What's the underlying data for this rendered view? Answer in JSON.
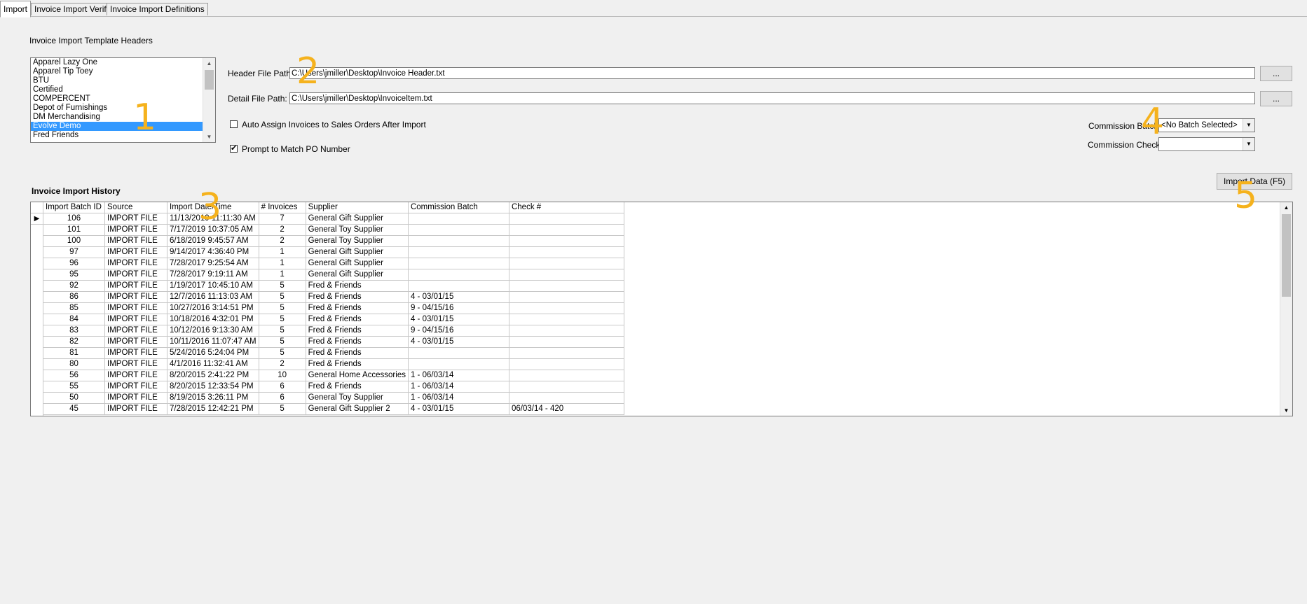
{
  "tabs": [
    "Import",
    "Invoice Import Verify",
    "Invoice Import Definitions"
  ],
  "templates": {
    "section_label": "Invoice Import Template Headers",
    "items": [
      "Apparel Lazy One",
      "Apparel Tip Toey",
      "BTU",
      "Certified",
      "COMPERCENT",
      "Depot of Furnishings",
      "DM Merchandising",
      "Evolve Demo",
      "Fred Friends"
    ],
    "selected": "Evolve Demo"
  },
  "paths": {
    "header_label": "Header File Path:",
    "header_value": "C:\\Users\\jmiller\\Desktop\\Invoice Header.txt",
    "detail_label": "Detail File Path:",
    "detail_value": "C:\\Users\\jmiller\\Desktop\\InvoiceItem.txt",
    "browse_label": "..."
  },
  "options": {
    "auto_assign_label": "Auto Assign Invoices to Sales Orders After Import",
    "auto_assign_checked": false,
    "prompt_match_label": "Prompt to Match PO Number",
    "prompt_match_checked": true,
    "check_mark": "✔"
  },
  "commission": {
    "batch_label": "Commission Batch",
    "batch_value": "<No Batch Selected>",
    "check_label": "Commission Check",
    "check_value": ""
  },
  "import_button": "Import Data (F5)",
  "history": {
    "title": "Invoice Import History",
    "columns": [
      "Import Batch ID",
      "Source",
      "Import Date/Time",
      "# Invoices",
      "Supplier",
      "Commission Batch",
      "Check #"
    ],
    "rows": [
      [
        "106",
        "IMPORT FILE",
        "11/13/2019 11:11:30 AM",
        "7",
        "General Gift Supplier",
        "",
        ""
      ],
      [
        "101",
        "IMPORT FILE",
        "7/17/2019 10:37:05 AM",
        "2",
        "General Toy Supplier",
        "",
        ""
      ],
      [
        "100",
        "IMPORT FILE",
        "6/18/2019 9:45:57 AM",
        "2",
        "General Toy Supplier",
        "",
        ""
      ],
      [
        "97",
        "IMPORT FILE",
        "9/14/2017 4:36:40 PM",
        "1",
        "General Gift Supplier",
        "",
        ""
      ],
      [
        "96",
        "IMPORT FILE",
        "7/28/2017 9:25:54 AM",
        "1",
        "General Gift Supplier",
        "",
        ""
      ],
      [
        "95",
        "IMPORT FILE",
        "7/28/2017 9:19:11 AM",
        "1",
        "General Gift Supplier",
        "",
        ""
      ],
      [
        "92",
        "IMPORT FILE",
        "1/19/2017 10:45:10 AM",
        "5",
        "Fred & Friends",
        "",
        ""
      ],
      [
        "86",
        "IMPORT FILE",
        "12/7/2016 11:13:03 AM",
        "5",
        "Fred & Friends",
        "4 - 03/01/15",
        ""
      ],
      [
        "85",
        "IMPORT FILE",
        "10/27/2016 3:14:51 PM",
        "5",
        "Fred & Friends",
        "9 - 04/15/16",
        ""
      ],
      [
        "84",
        "IMPORT FILE",
        "10/18/2016 4:32:01 PM",
        "5",
        "Fred & Friends",
        "4 - 03/01/15",
        ""
      ],
      [
        "83",
        "IMPORT FILE",
        "10/12/2016 9:13:30 AM",
        "5",
        "Fred & Friends",
        "9 - 04/15/16",
        ""
      ],
      [
        "82",
        "IMPORT FILE",
        "10/11/2016 11:07:47 AM",
        "5",
        "Fred & Friends",
        "4 - 03/01/15",
        ""
      ],
      [
        "81",
        "IMPORT FILE",
        "5/24/2016 5:24:04 PM",
        "5",
        "Fred & Friends",
        "",
        ""
      ],
      [
        "80",
        "IMPORT FILE",
        "4/1/2016 11:32:41 AM",
        "2",
        "Fred & Friends",
        "",
        ""
      ],
      [
        "56",
        "IMPORT FILE",
        "8/20/2015 2:41:22 PM",
        "10",
        "General Home Accessories",
        "1 - 06/03/14",
        ""
      ],
      [
        "55",
        "IMPORT FILE",
        "8/20/2015 12:33:54 PM",
        "6",
        "Fred & Friends",
        "1 - 06/03/14",
        ""
      ],
      [
        "50",
        "IMPORT FILE",
        "8/19/2015 3:26:11 PM",
        "6",
        "General Toy Supplier",
        "1 - 06/03/14",
        ""
      ],
      [
        "45",
        "IMPORT FILE",
        "7/28/2015 12:42:21 PM",
        "5",
        "General Gift Supplier 2",
        "4 - 03/01/15",
        "06/03/14 - 420"
      ]
    ]
  },
  "callouts": [
    "1",
    "2",
    "3",
    "4",
    "5"
  ],
  "colors": {
    "callout": "#f5b21d",
    "selection": "#3399ff"
  }
}
